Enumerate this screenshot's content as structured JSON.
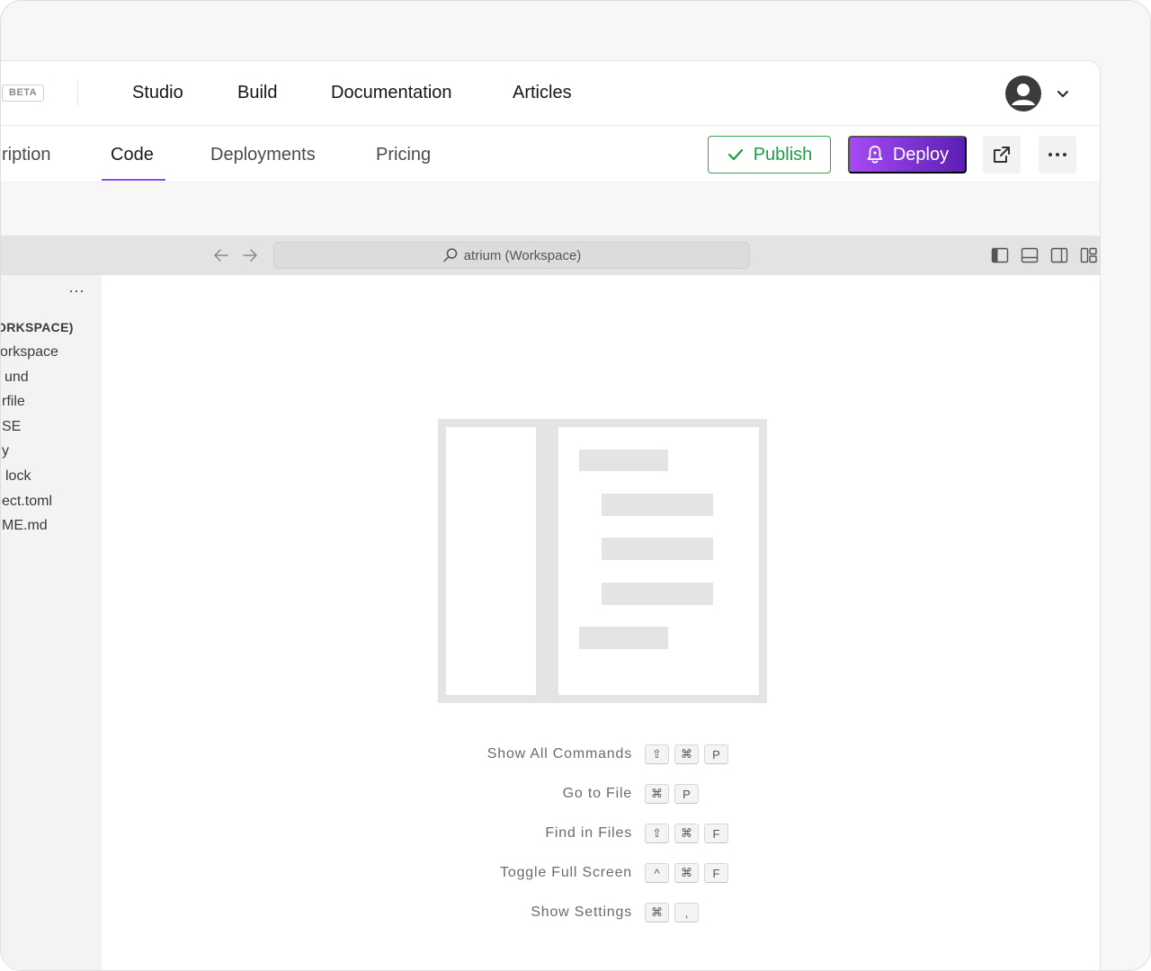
{
  "top_nav": {
    "badge": "BETA",
    "links": [
      "Studio",
      "Build",
      "Documentation",
      "Articles"
    ]
  },
  "tabs": [
    {
      "label": "Description",
      "visible_text": "ription"
    },
    {
      "label": "Code",
      "active": true
    },
    {
      "label": "Deployments"
    },
    {
      "label": "Pricing"
    }
  ],
  "actions": {
    "publish_label": "Publish",
    "deploy_label": "Deploy"
  },
  "editor": {
    "command_center": "atrium (Workspace)"
  },
  "explorer": {
    "items": [
      "ORKSPACE)",
      "orkspace",
      "und",
      "rfile",
      "SE",
      "y",
      "lock",
      "ect.toml",
      "ME.md"
    ]
  },
  "welcome": {
    "shortcuts": [
      {
        "label": "Show All Commands",
        "keys": [
          "⇧",
          "⌘",
          "P"
        ]
      },
      {
        "label": "Go to File",
        "keys": [
          "⌘",
          "P"
        ]
      },
      {
        "label": "Find in Files",
        "keys": [
          "⇧",
          "⌘",
          "F"
        ]
      },
      {
        "label": "Toggle Full Screen",
        "keys": [
          "^",
          "⌘",
          "F"
        ]
      },
      {
        "label": "Show Settings",
        "keys": [
          "⌘",
          ","
        ]
      }
    ]
  },
  "colors": {
    "accent_purple": "#8a4de8",
    "publish_green": "#1f9a48",
    "deploy_gradient_start": "#a64bf4",
    "deploy_gradient_end": "#5b1fb4"
  }
}
